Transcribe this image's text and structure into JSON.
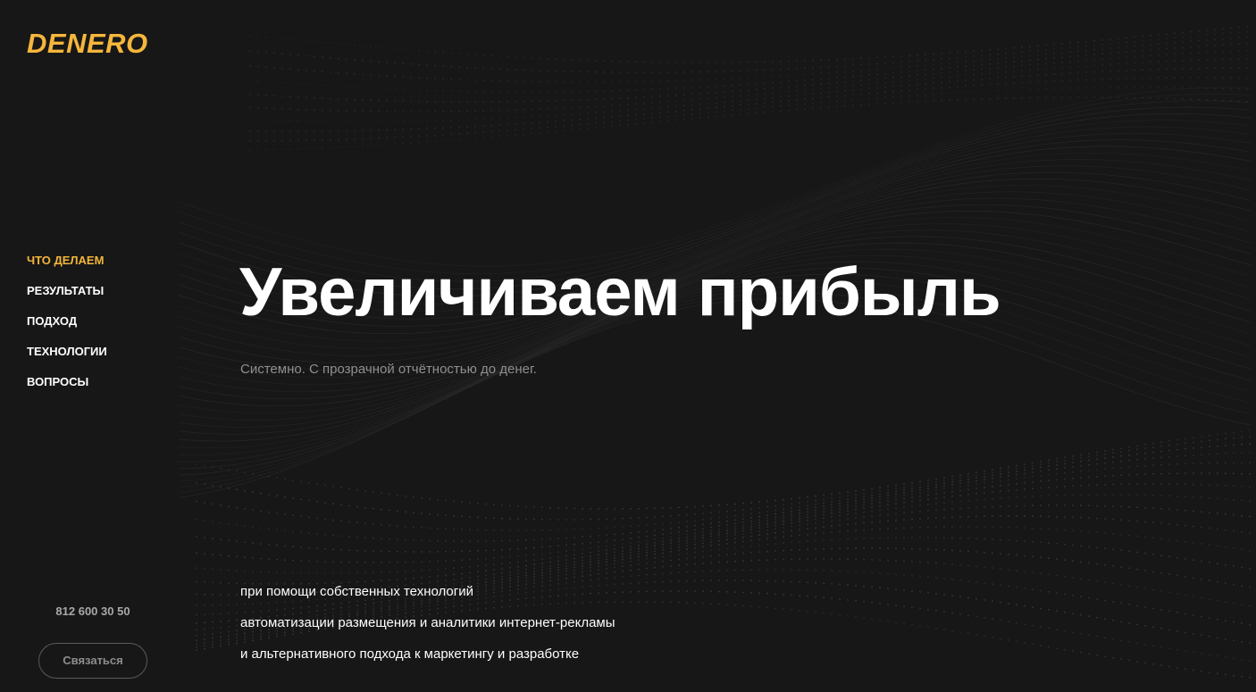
{
  "brand": {
    "logo_text": "DENERO",
    "accent_color": "#f5b63b",
    "background_color": "#171717"
  },
  "nav": {
    "items": [
      {
        "label": "ЧТО ДЕЛАЕМ",
        "active": true
      },
      {
        "label": "РЕЗУЛЬТАТЫ",
        "active": false
      },
      {
        "label": "ПОДХОД",
        "active": false
      },
      {
        "label": "ТЕХНОЛОГИИ",
        "active": false
      },
      {
        "label": "ВОПРОСЫ",
        "active": false
      }
    ]
  },
  "contact": {
    "phone": "812 600 30 50",
    "button_label": "Связаться"
  },
  "hero": {
    "headline": "Увеличиваем прибыль",
    "subtitle": "Системно. С прозрачной отчётностью до денег.",
    "features": [
      "при помощи собственных технологий",
      "автоматизации размещения и аналитики интернет-рекламы",
      "и альтернативного подхода к маркетингу и разработке"
    ]
  }
}
